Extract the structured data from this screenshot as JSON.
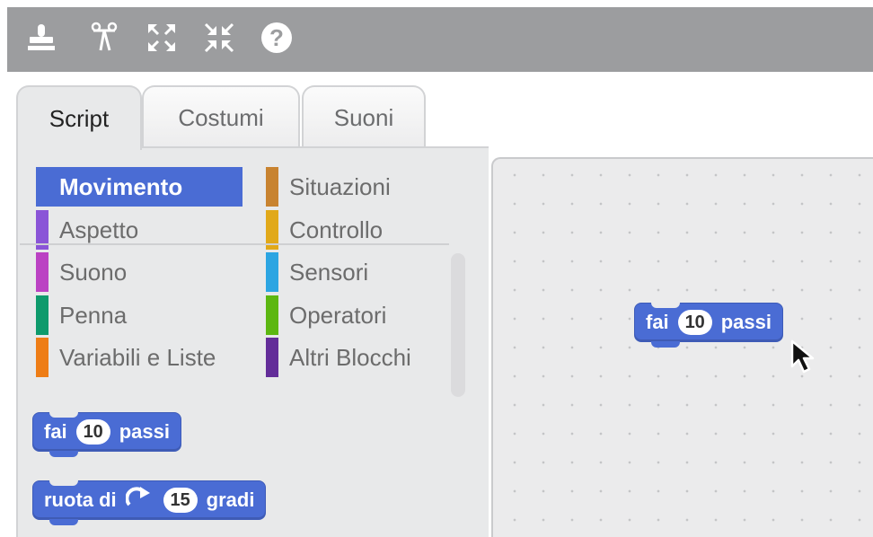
{
  "toolbar": {
    "tools": [
      {
        "icon": "stamp-icon"
      },
      {
        "icon": "scissors-icon"
      },
      {
        "icon": "grow-icon"
      },
      {
        "icon": "shrink-icon"
      },
      {
        "icon": "help-icon"
      }
    ]
  },
  "tabs": [
    {
      "label": "Script",
      "active": true
    },
    {
      "label": "Costumi",
      "active": false
    },
    {
      "label": "Suoni",
      "active": false
    }
  ],
  "categories": [
    {
      "label": "Movimento",
      "color": "#4a6cd4",
      "selected": true
    },
    {
      "label": "Aspetto",
      "color": "#8a55d7"
    },
    {
      "label": "Suono",
      "color": "#bb42c3"
    },
    {
      "label": "Penna",
      "color": "#0e9a6c"
    },
    {
      "label": "Variabili e Liste",
      "color": "#ee7d16"
    },
    {
      "label": "Situazioni",
      "color": "#c88330"
    },
    {
      "label": "Controllo",
      "color": "#e1a91a"
    },
    {
      "label": "Sensori",
      "color": "#2ca5e2"
    },
    {
      "label": "Operatori",
      "color": "#5cb712"
    },
    {
      "label": "Altri Blocchi",
      "color": "#632d99"
    }
  ],
  "palette_blocks": [
    {
      "pre": "fai",
      "value": "10",
      "post": "passi"
    },
    {
      "pre": "ruota di",
      "icon": "rotate-clockwise-icon",
      "value": "15",
      "post": "gradi"
    }
  ],
  "canvas_block": {
    "pre": "fai",
    "value": "10",
    "post": "passi"
  }
}
